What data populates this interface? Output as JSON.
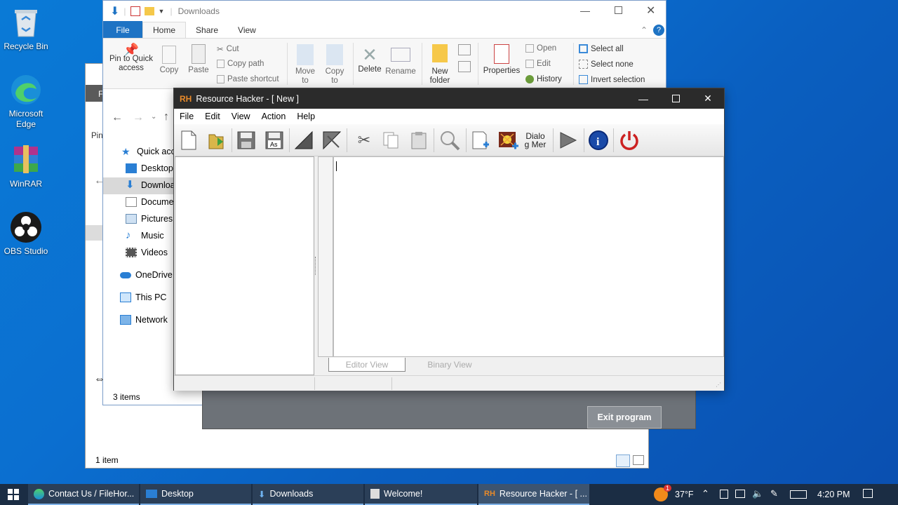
{
  "desktop": {
    "icons": [
      {
        "label": "Recycle Bin",
        "icon": "recycle-bin-icon"
      },
      {
        "label": "Microsoft Edge",
        "icon": "edge-icon"
      },
      {
        "label": "WinRAR",
        "icon": "winrar-icon"
      },
      {
        "label": "OBS Studio",
        "icon": "obs-icon"
      }
    ]
  },
  "back_window": {
    "frag_title": "F",
    "frag_pin": "Pin",
    "status": "1 item"
  },
  "explorer": {
    "title": "Downloads",
    "tabs": [
      "File",
      "Home",
      "Share",
      "View"
    ],
    "ribbon": {
      "pin": "Pin to Quick access",
      "copy": "Copy",
      "paste": "Paste",
      "cut": "Cut",
      "copy_path": "Copy path",
      "paste_shortcut": "Paste shortcut",
      "move_to": "Move to",
      "copy_to": "Copy to",
      "delete": "Delete",
      "rename": "Rename",
      "new_folder": "New folder",
      "properties": "Properties",
      "open": "Open",
      "edit": "Edit",
      "history": "History",
      "select_all": "Select all",
      "select_none": "Select none",
      "invert_selection": "Invert selection"
    },
    "nav": {
      "quick_access": "Quick acce",
      "desktop": "Desktop",
      "downloads": "Downloa",
      "documents": "Documer",
      "pictures": "Pictures",
      "music": "Music",
      "videos": "Videos",
      "onedrive": "OneDrive",
      "this_pc": "This PC",
      "network": "Network"
    },
    "status": "3 items"
  },
  "welcome": {
    "exit_button": "Exit program"
  },
  "resource_hacker": {
    "title": "Resource Hacker - [ New ]",
    "menu": [
      "File",
      "Edit",
      "View",
      "Action",
      "Help"
    ],
    "toolbar_icons": [
      "new-file-icon",
      "open-file-icon",
      "save-icon",
      "save-as-icon",
      "compile-icon",
      "decompile-icon",
      "cut-icon",
      "copy-icon",
      "paste-icon",
      "find-icon",
      "add-resource-icon",
      "add-image-icon",
      "dialog-menu-icon",
      "run-icon",
      "info-icon",
      "exit-icon"
    ],
    "dialog_label": "Dialog Mer",
    "save_as_label": "As",
    "editor_view_tab": "Editor View",
    "binary_view_tab": "Binary View"
  },
  "taskbar": {
    "items": [
      "Contact Us / FileHor...",
      "Desktop",
      "Downloads",
      "Welcome!",
      "Resource Hacker - [ ..."
    ],
    "weather": "37°F",
    "time": "4:20 PM",
    "notification_count": "1"
  },
  "colors": {
    "accent": "#1e73c4",
    "taskbar": "#1b2d44",
    "rh_title": "#2b2b2b"
  }
}
